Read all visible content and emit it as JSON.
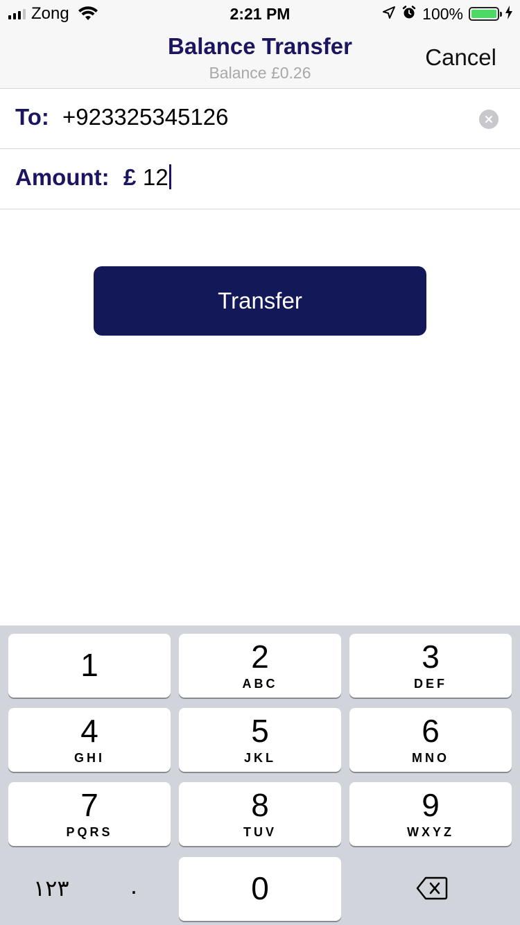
{
  "status_bar": {
    "carrier": "Zong",
    "time": "2:21 PM",
    "battery_percent": "100%",
    "battery_color": "#4cd964",
    "icons": [
      "cellular-signal-icon",
      "wifi-icon",
      "location-arrow-icon",
      "alarm-clock-icon",
      "battery-icon",
      "charging-bolt-icon"
    ]
  },
  "nav": {
    "title": "Balance Transfer",
    "subtitle": "Balance £0.26",
    "cancel_label": "Cancel"
  },
  "form": {
    "to_label": "To:",
    "to_value": "+923325345126",
    "amount_label": "Amount:",
    "currency_symbol": "£",
    "amount_value": "12"
  },
  "transfer_button": {
    "label": "Transfer",
    "color": "#121858"
  },
  "keypad": {
    "keys": [
      {
        "digit": "1",
        "letters": ""
      },
      {
        "digit": "2",
        "letters": "ABC"
      },
      {
        "digit": "3",
        "letters": "DEF"
      },
      {
        "digit": "4",
        "letters": "GHI"
      },
      {
        "digit": "5",
        "letters": "JKL"
      },
      {
        "digit": "6",
        "letters": "MNO"
      },
      {
        "digit": "7",
        "letters": "PQRS"
      },
      {
        "digit": "8",
        "letters": "TUV"
      },
      {
        "digit": "9",
        "letters": "WXYZ"
      },
      {
        "digit": "0",
        "letters": ""
      }
    ],
    "arabic_digits_label": "١٢٣",
    "decimal_label": "."
  },
  "colors": {
    "accent": "#1c1660",
    "muted": "#a8a8a8",
    "keypad_bg": "#d1d4da"
  }
}
